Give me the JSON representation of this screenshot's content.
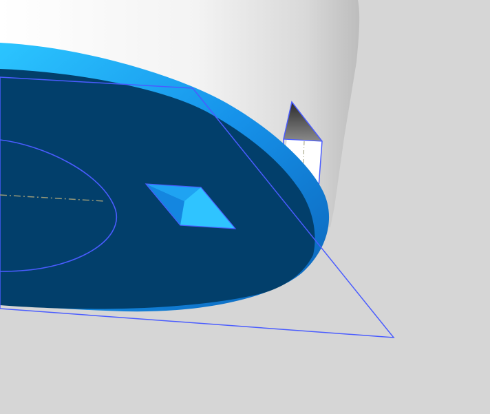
{
  "viewport": {
    "background_color": "#d6d6d6",
    "model": {
      "cylinder_body_color": "#e4e4e4",
      "disc_top_face_color": "#023f6b",
      "disc_rim_color": "#1a8fe6",
      "disc_highlight_color": "#2cc6ff",
      "sketch_plane_outline_color": "#4a5cff",
      "sketch_circle_color": "#4a5cff",
      "centerline_color": "#9a9a78",
      "pocket_side_face_color": "#3a3a3a",
      "pocket_inner_face_color": "#ffffff",
      "slot_feature_color": "#2fc4ff"
    }
  }
}
